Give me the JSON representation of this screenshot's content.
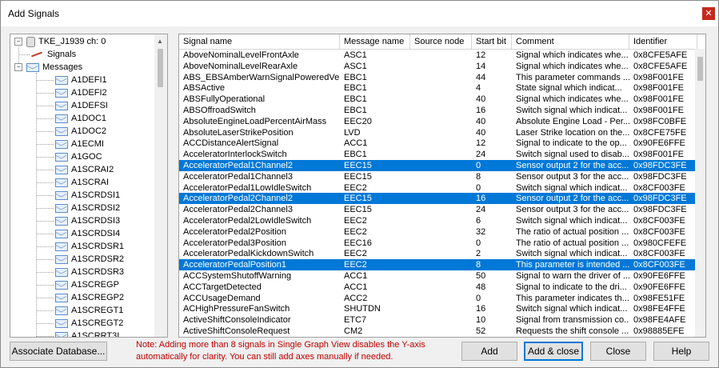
{
  "window": {
    "title": "Add Signals",
    "close_glyph": "✕"
  },
  "tree": {
    "root_label": "TKE_J1939 ch: 0",
    "signals_label": "Signals",
    "messages_label": "Messages",
    "messages": [
      "A1DEFI1",
      "A1DEFI2",
      "A1DEFSI",
      "A1DOC1",
      "A1DOC2",
      "A1ECMI",
      "A1GOC",
      "A1SCRAI2",
      "A1SCRAI",
      "A1SCRDSI1",
      "A1SCRDSI2",
      "A1SCRDSI3",
      "A1SCRDSI4",
      "A1SCRDSR1",
      "A1SCRDSR2",
      "A1SCRDSR3",
      "A1SCREGP",
      "A1SCREGP2",
      "A1SCREGT1",
      "A1SCREGT2",
      "A1SCRRT3I"
    ]
  },
  "table": {
    "columns": [
      "Signal name",
      "Message name",
      "Source node",
      "Start bit",
      "Comment",
      "Identifier"
    ],
    "rows": [
      {
        "name": "AboveNominalLevelFrontAxle",
        "msg": "ASC1",
        "src": "",
        "bit": "12",
        "comment": "Signal which indicates whe...",
        "id": "0x8CFE5AFE",
        "selected": false
      },
      {
        "name": "AboveNominalLevelRearAxle",
        "msg": "ASC1",
        "src": "",
        "bit": "14",
        "comment": "Signal which indicates whe...",
        "id": "0x8CFE5AFE",
        "selected": false
      },
      {
        "name": "ABS_EBSAmberWarnSignalPoweredVeh",
        "msg": "EBC1",
        "src": "",
        "bit": "44",
        "comment": "This parameter commands ...",
        "id": "0x98F001FE",
        "selected": false
      },
      {
        "name": "ABSActive",
        "msg": "EBC1",
        "src": "",
        "bit": "4",
        "comment": "State signal which indicat...",
        "id": "0x98F001FE",
        "selected": false
      },
      {
        "name": "ABSFullyOperational",
        "msg": "EBC1",
        "src": "",
        "bit": "40",
        "comment": "Signal which indicates whe...",
        "id": "0x98F001FE",
        "selected": false
      },
      {
        "name": "ABSOffroadSwitch",
        "msg": "EBC1",
        "src": "",
        "bit": "16",
        "comment": "Switch signal which indicat...",
        "id": "0x98F001FE",
        "selected": false
      },
      {
        "name": "AbsoluteEngineLoadPercentAirMass",
        "msg": "EEC20",
        "src": "",
        "bit": "40",
        "comment": "Absolute Engine Load - Per...",
        "id": "0x98FC0BFE",
        "selected": false
      },
      {
        "name": "AbsoluteLaserStrikePosition",
        "msg": "LVD",
        "src": "",
        "bit": "40",
        "comment": "Laser Strike location on the...",
        "id": "0x8CFE75FE",
        "selected": false
      },
      {
        "name": "ACCDistanceAlertSignal",
        "msg": "ACC1",
        "src": "",
        "bit": "12",
        "comment": "Signal to indicate to the op...",
        "id": "0x90FE6FFE",
        "selected": false
      },
      {
        "name": "AcceleratorInterlockSwitch",
        "msg": "EBC1",
        "src": "",
        "bit": "24",
        "comment": "Switch signal used to disab...",
        "id": "0x98F001FE",
        "selected": false
      },
      {
        "name": "AcceleratorPedal1Channel2",
        "msg": "EEC15",
        "src": "",
        "bit": "0",
        "comment": "Sensor output 2 for the acc...",
        "id": "0x98FDC3FE",
        "selected": true
      },
      {
        "name": "AcceleratorPedal1Channel3",
        "msg": "EEC15",
        "src": "",
        "bit": "8",
        "comment": "Sensor output 3 for the acc...",
        "id": "0x98FDC3FE",
        "selected": false
      },
      {
        "name": "AcceleratorPedal1LowIdleSwitch",
        "msg": "EEC2",
        "src": "",
        "bit": "0",
        "comment": "Switch signal which indicat...",
        "id": "0x8CF003FE",
        "selected": false
      },
      {
        "name": "AcceleratorPedal2Channel2",
        "msg": "EEC15",
        "src": "",
        "bit": "16",
        "comment": "Sensor output 2 for the acc...",
        "id": "0x98FDC3FE",
        "selected": true
      },
      {
        "name": "AcceleratorPedal2Channel3",
        "msg": "EEC15",
        "src": "",
        "bit": "24",
        "comment": "Sensor output 3 for the acc...",
        "id": "0x98FDC3FE",
        "selected": false
      },
      {
        "name": "AcceleratorPedal2LowIdleSwitch",
        "msg": "EEC2",
        "src": "",
        "bit": "6",
        "comment": "Switch signal which indicat...",
        "id": "0x8CF003FE",
        "selected": false
      },
      {
        "name": "AcceleratorPedal2Position",
        "msg": "EEC2",
        "src": "",
        "bit": "32",
        "comment": "The ratio of actual position ...",
        "id": "0x8CF003FE",
        "selected": false
      },
      {
        "name": "AcceleratorPedal3Position",
        "msg": "EEC16",
        "src": "",
        "bit": "0",
        "comment": "The ratio of actual position ...",
        "id": "0x980CFEFE",
        "selected": false
      },
      {
        "name": "AcceleratorPedalKickdownSwitch",
        "msg": "EEC2",
        "src": "",
        "bit": "2",
        "comment": "Switch signal which indicat...",
        "id": "0x8CF003FE",
        "selected": false
      },
      {
        "name": "AcceleratorPedalPosition1",
        "msg": "EEC2",
        "src": "",
        "bit": "8",
        "comment": "This parameter is intended ...",
        "id": "0x8CF003FE",
        "selected": true
      },
      {
        "name": "ACCSystemShutoffWarning",
        "msg": "ACC1",
        "src": "",
        "bit": "50",
        "comment": "Signal to warn the driver of ...",
        "id": "0x90FE6FFE",
        "selected": false
      },
      {
        "name": "ACCTargetDetected",
        "msg": "ACC1",
        "src": "",
        "bit": "48",
        "comment": "Signal to indicate to the dri...",
        "id": "0x90FE6FFE",
        "selected": false
      },
      {
        "name": "ACCUsageDemand",
        "msg": "ACC2",
        "src": "",
        "bit": "0",
        "comment": "This parameter indicates th...",
        "id": "0x98FE51FE",
        "selected": false
      },
      {
        "name": "ACHighPressureFanSwitch",
        "msg": "SHUTDN",
        "src": "",
        "bit": "16",
        "comment": "Switch signal which indicat...",
        "id": "0x98FE4FFE",
        "selected": false
      },
      {
        "name": "ActiveShiftConsoleIndicator",
        "msg": "ETC7",
        "src": "",
        "bit": "10",
        "comment": "Signal from transmission co...",
        "id": "0x98FE4AFE",
        "selected": false
      },
      {
        "name": "ActiveShiftConsoleRequest",
        "msg": "CM2",
        "src": "",
        "bit": "52",
        "comment": "Requests the shift console ...",
        "id": "0x98885EFE",
        "selected": false
      }
    ]
  },
  "buttons": {
    "associate_db": "Associate Database...",
    "add": "Add",
    "add_close": "Add & close",
    "close": "Close",
    "help": "Help"
  },
  "note": "Note: Adding more than 8 signals in Single Graph View disables the Y-axis automatically for clarity. You can still add axes manually if needed."
}
